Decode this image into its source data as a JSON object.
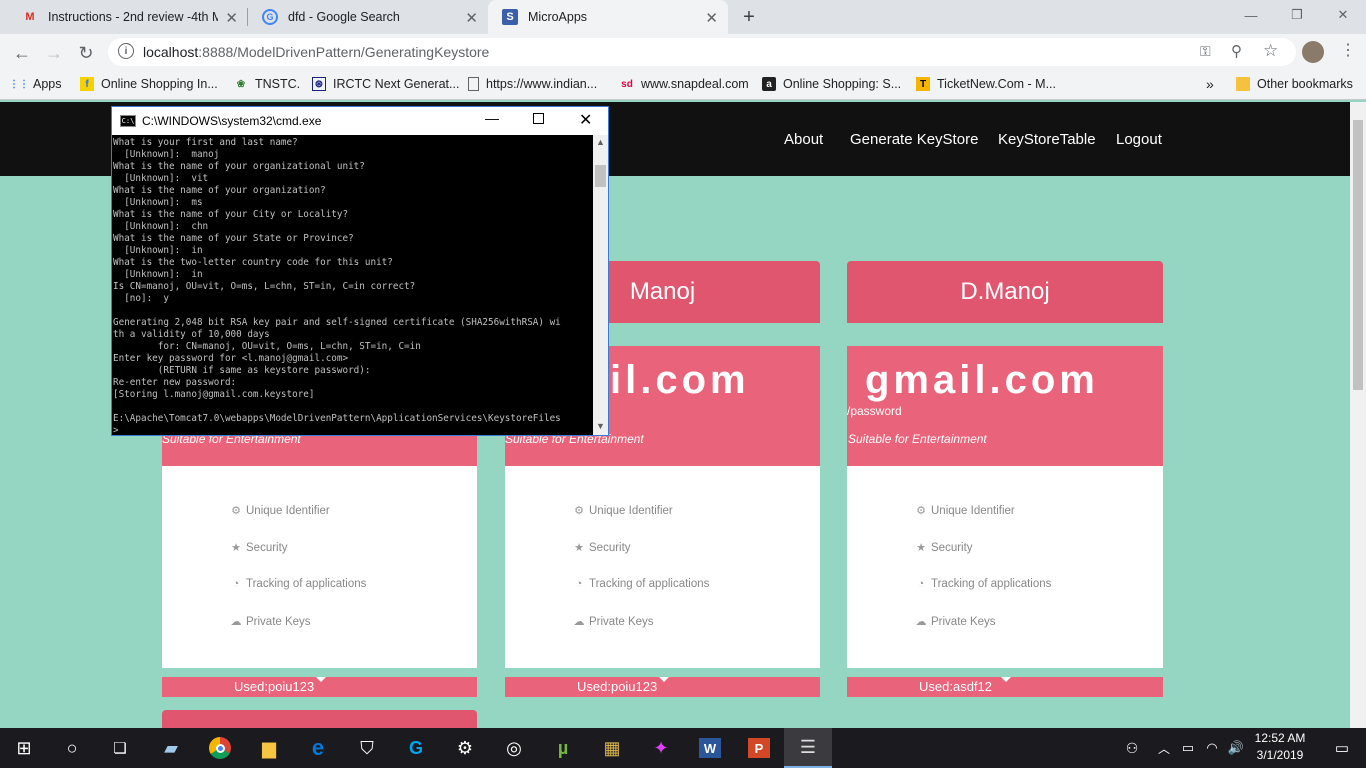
{
  "browser": {
    "tabs": [
      {
        "title": "Instructions - 2nd review -4th Ma",
        "icon": "gmail-icon"
      },
      {
        "title": "dfd - Google Search",
        "icon": "google-icon"
      },
      {
        "title": "MicroApps",
        "icon": "s-icon"
      }
    ],
    "new_tab": "+",
    "url_host": "localhost",
    "url_rest": ":8888/ModelDrivenPattern/GeneratingKeystore",
    "bookmarks": [
      {
        "label": "Apps"
      },
      {
        "label": "Online Shopping In..."
      },
      {
        "label": "TNSTC."
      },
      {
        "label": "IRCTC Next Generat..."
      },
      {
        "label": "https://www.indian..."
      },
      {
        "label": "www.snapdeal.com"
      },
      {
        "label": "Online Shopping: S..."
      },
      {
        "label": "TicketNew.Com - M..."
      }
    ],
    "more_bookmarks": "»",
    "other_bookmarks": "Other bookmarks"
  },
  "site": {
    "nav": [
      "About",
      "Generate KeyStore",
      "KeyStoreTable",
      "Logout"
    ],
    "cards": [
      {
        "name": "",
        "email": "",
        "password_label": "",
        "tagline": "Suitable for Entertainment",
        "used": "Used:poiu123"
      },
      {
        "name": "Manoj",
        "email": "il.com",
        "password_label": "",
        "tagline": "Suitable for Entertainment",
        "used": "Used:poiu123"
      },
      {
        "name": "D.Manoj",
        "email": "gmail.com",
        "password_label": "/password",
        "tagline": "Suitable for Entertainment",
        "used": "Used:asdf12"
      }
    ],
    "features": [
      "Unique Identifier",
      "Security",
      "Tracking of applications",
      "Private Keys"
    ]
  },
  "cmd": {
    "title": "C:\\WINDOWS\\system32\\cmd.exe",
    "lines": [
      "What is your first and last name?",
      "  [Unknown]:  manoj",
      "What is the name of your organizational unit?",
      "  [Unknown]:  vit",
      "What is the name of your organization?",
      "  [Unknown]:  ms",
      "What is the name of your City or Locality?",
      "  [Unknown]:  chn",
      "What is the name of your State or Province?",
      "  [Unknown]:  in",
      "What is the two-letter country code for this unit?",
      "  [Unknown]:  in",
      "Is CN=manoj, OU=vit, O=ms, L=chn, ST=in, C=in correct?",
      "  [no]:  y",
      "",
      "Generating 2,048 bit RSA key pair and self-signed certificate (SHA256withRSA) wi",
      "th a validity of 10,000 days",
      "        for: CN=manoj, OU=vit, O=ms, L=chn, ST=in, C=in",
      "Enter key password for <l.manoj@gmail.com>",
      "        (RETURN if same as keystore password):",
      "Re-enter new password:",
      "[Storing l.manoj@gmail.com.keystore]",
      "",
      "E:\\Apache\\Tomcat7.0\\webapps\\ModelDrivenPattern\\ApplicationServices\\KeystoreFiles",
      ">"
    ]
  },
  "taskbar": {
    "time": "12:52 AM",
    "date": "3/1/2019"
  },
  "colors": {
    "page_bg": "#95d6c3",
    "card_head": "#e0566f",
    "card_mid": "#e9637a",
    "site_bar": "#111111"
  }
}
